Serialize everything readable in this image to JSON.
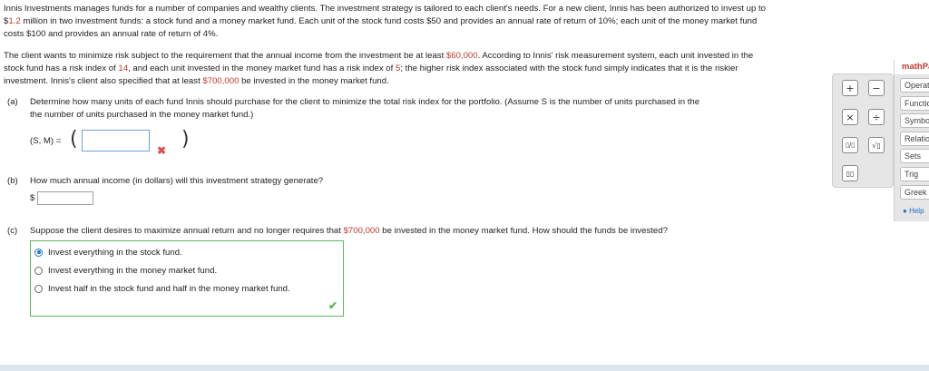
{
  "intro": {
    "l1": "Innis Investments manages funds for a number of companies and wealthy clients. The investment strategy is tailored to each client's needs. For a new client, Innis has been authorized to invest up to",
    "l2a": "$",
    "l2b": "1.2",
    "l2c": " million in two investment funds: a stock fund and a money market fund. Each unit of the stock fund costs $50 and provides an annual rate of return of 10%; each unit of the money market fund",
    "l3": "costs $100 and provides an annual rate of return of 4%."
  },
  "client": {
    "l1a": "The client wants to minimize risk subject to the requirement that the annual income from the investment be at least ",
    "l1b": "$60,000",
    "l1c": ". According to Innis' risk measurement system, each unit invested in the",
    "l2a": "stock fund has a risk index of ",
    "l2b": "14",
    "l2c": ", and each unit invested in the money market fund has a risk index of ",
    "l2d": "5",
    "l2e": "; the higher risk index associated with the stock fund simply indicates that it is the riskier",
    "l3a": "investment. Innis's client also specified that at least ",
    "l3b": "$700,000",
    "l3c": " be invested in the money market fund."
  },
  "part_a": {
    "label": "(a)",
    "l1": "Determine how many units of each fund Innis should purchase for the client to minimize the total risk index for the portfolio. (Assume S is the number of units purchased in the",
    "l2": "the number of units purchased in the money market fund.)",
    "expr": "(S, M) =",
    "open_paren": "(",
    "close_paren": ")",
    "mark": "✖"
  },
  "part_b": {
    "label": "(b)",
    "text": "How much annual income (in dollars) will this investment strategy generate?",
    "dollar": "$"
  },
  "part_c": {
    "label": "(c)",
    "text_a": "Suppose the client desires to maximize annual return and no longer requires that ",
    "text_b": "$700,000",
    "text_c": " be invested in the money market fund. How should the funds be invested?",
    "options": [
      "Invest everything in the stock fund.",
      "Invest everything in the money market fund.",
      "Invest half in the stock fund and half in the money market fund."
    ],
    "selected": 0,
    "check": "✔"
  },
  "palette": {
    "buttons": [
      "+",
      "−",
      "×",
      "÷",
      "▯/▯",
      "√▯",
      "▯▯"
    ]
  },
  "side": {
    "header": "mathPad",
    "tabs": [
      "Operations",
      "Functions",
      "Symbols",
      "Relations",
      "Sets",
      "Trig",
      "Greek"
    ],
    "help": "Help"
  },
  "colors": {
    "highlight": "#c0392b",
    "correct": "#5cb85c",
    "accent": "#1a73c8"
  }
}
